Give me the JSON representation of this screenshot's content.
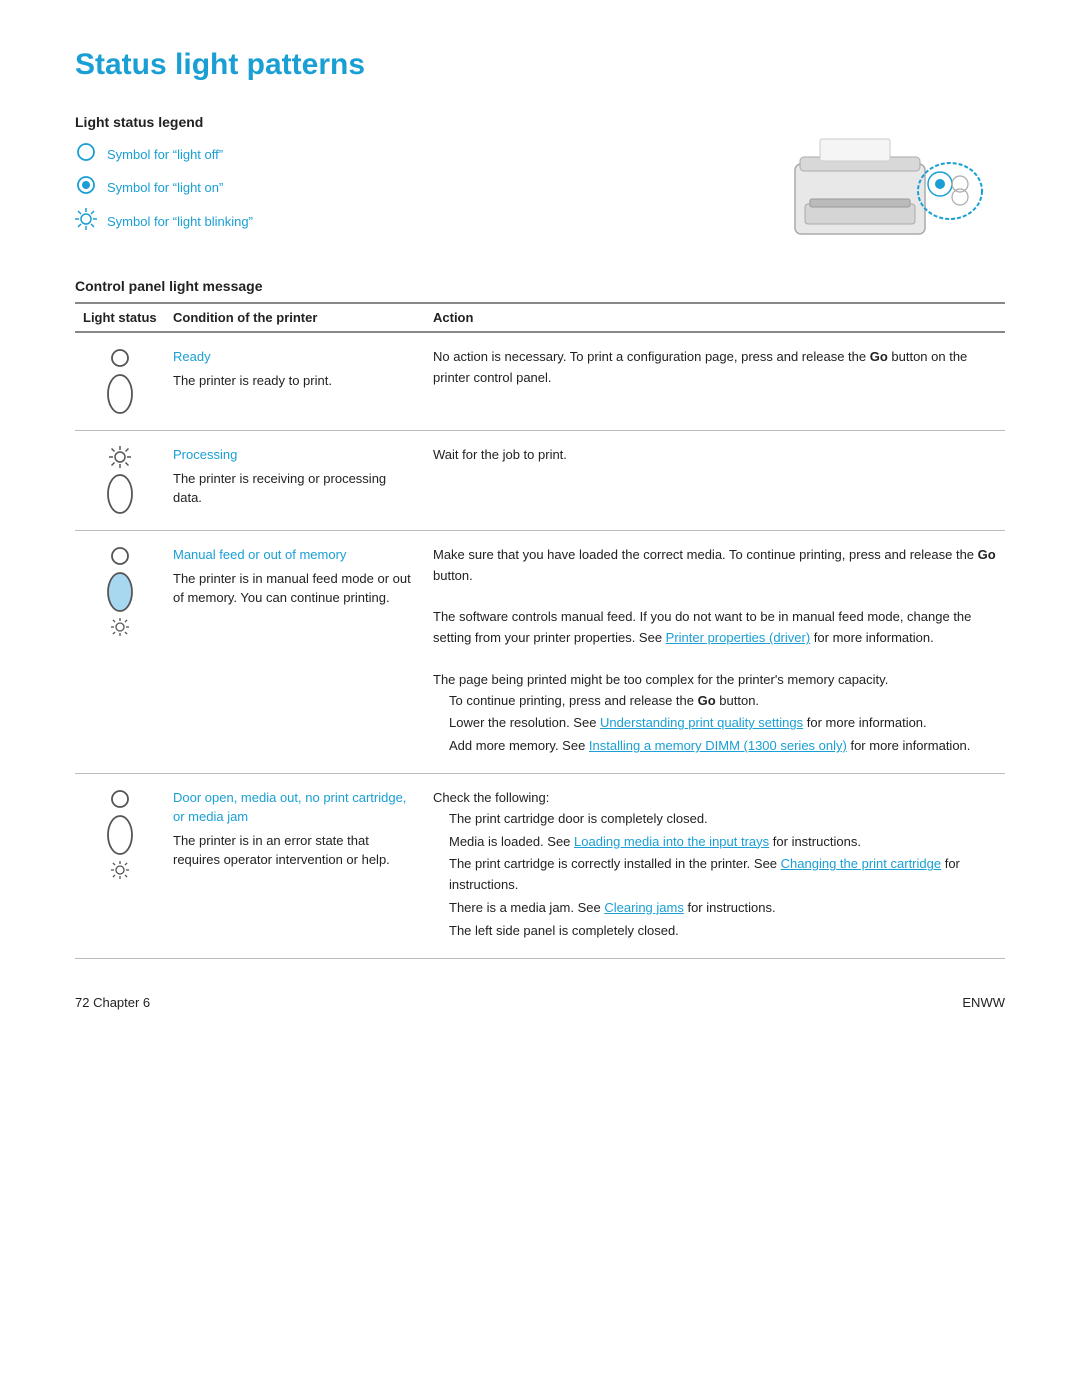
{
  "page": {
    "title": "Status light patterns",
    "footer_left": "72  Chapter 6",
    "footer_right": "ENWW"
  },
  "legend": {
    "title": "Light status legend",
    "items": [
      {
        "symbol": "off",
        "text": "Symbol for “light off”"
      },
      {
        "symbol": "on",
        "text": "Symbol for “light on”"
      },
      {
        "symbol": "blink",
        "text": "Symbol for “light blinking”"
      }
    ]
  },
  "control_panel": {
    "title": "Control panel light message"
  },
  "table": {
    "headers": [
      "Light status",
      "Condition of the printer",
      "Action"
    ],
    "rows": [
      {
        "light_status": "off-top, off-oval",
        "condition_title": "Ready",
        "condition_desc": "The printer is ready to print.",
        "action": "No action is necessary. To print a configuration page, press and release the Go button on the printer control panel."
      },
      {
        "light_status": "blink-top, off-oval",
        "condition_title": "Processing",
        "condition_desc": "The printer is receiving or processing data.",
        "action": "Wait for the job to print."
      },
      {
        "light_status": "off-top, blink-oval-filled",
        "condition_title": "Manual feed or out of memory",
        "condition_desc": "The printer is in manual feed mode or out of memory. You can continue printing.",
        "action_parts": [
          {
            "type": "text",
            "text": "Make sure that you have loaded the correct media. To continue printing, press and release the "
          },
          {
            "type": "bold",
            "text": "Go"
          },
          {
            "type": "text",
            "text": " button."
          },
          {
            "type": "newline"
          },
          {
            "type": "text",
            "text": "The software controls manual feed. If you do not want to be in manual feed mode, change the setting from your printer properties. See "
          },
          {
            "type": "link",
            "text": "Printer properties (driver)"
          },
          {
            "type": "text",
            "text": " for more information."
          },
          {
            "type": "newline"
          },
          {
            "type": "text",
            "text": "The page being printed might be too complex for the printer’s memory capacity."
          },
          {
            "type": "newline"
          },
          {
            "type": "indent",
            "text": "To continue printing, press and release the "
          },
          {
            "type": "indent-bold",
            "text": "Go"
          },
          {
            "type": "indent-text",
            "text": " button."
          },
          {
            "type": "newline"
          },
          {
            "type": "indent",
            "text": "Lower the resolution. See "
          },
          {
            "type": "indent-link",
            "text": "Understanding print quality settings"
          },
          {
            "type": "indent-text",
            "text": " for more information."
          },
          {
            "type": "newline"
          },
          {
            "type": "indent",
            "text": "Add more memory. See "
          },
          {
            "type": "indent-link",
            "text": "Installing a memory DIMM (1300 series only)"
          },
          {
            "type": "indent-text",
            "text": " for more information."
          }
        ]
      },
      {
        "light_status": "off-top, blink-oval-empty",
        "condition_title": "Door open, media out, no print cartridge, or media jam",
        "condition_desc": "The printer is in an error state that requires operator intervention or help.",
        "action_parts": [
          {
            "type": "text",
            "text": "Check the following:"
          },
          {
            "type": "newline"
          },
          {
            "type": "indent-plain",
            "text": "The print cartridge door is completely closed."
          },
          {
            "type": "newline"
          },
          {
            "type": "indent-plain",
            "text": "Media is loaded. See "
          },
          {
            "type": "indent-link2",
            "text": "Loading media into the input trays"
          },
          {
            "type": "indent-plain2",
            "text": " for instructions."
          },
          {
            "type": "newline"
          },
          {
            "type": "indent-plain",
            "text": "The print cartridge is correctly installed in the printer. See "
          },
          {
            "type": "indent-link2",
            "text": "Changing the print cartridge"
          },
          {
            "type": "indent-plain2",
            "text": " for instructions."
          },
          {
            "type": "newline"
          },
          {
            "type": "indent-plain",
            "text": "There is a media jam. See "
          },
          {
            "type": "indent-link2",
            "text": "Clearing jams"
          },
          {
            "type": "indent-plain2",
            "text": " for instructions."
          },
          {
            "type": "newline"
          },
          {
            "type": "indent-plain",
            "text": "The left side panel is completely closed."
          }
        ]
      }
    ]
  }
}
